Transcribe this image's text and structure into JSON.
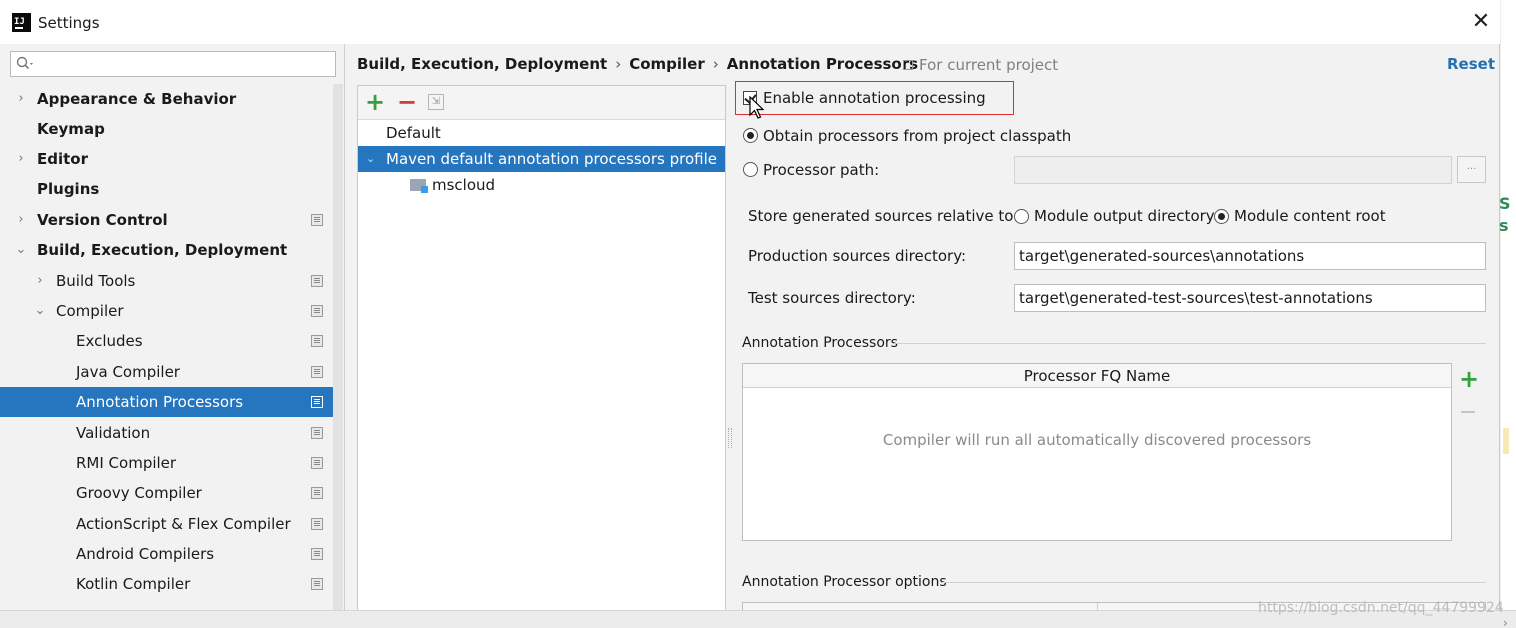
{
  "window": {
    "title": "Settings",
    "close_label": "✕"
  },
  "search": {
    "placeholder": "Q▾"
  },
  "sidebar": {
    "items": [
      {
        "label": "Appearance & Behavior",
        "chevron": "›",
        "bold": true
      },
      {
        "label": "Keymap",
        "chevron": "",
        "bold": true
      },
      {
        "label": "Editor",
        "chevron": "›",
        "bold": true
      },
      {
        "label": "Plugins",
        "chevron": "",
        "bold": true
      },
      {
        "label": "Version Control",
        "chevron": "›",
        "bold": true
      },
      {
        "label": "Build, Execution, Deployment",
        "chevron": "⌄",
        "bold": true
      },
      {
        "label": "Build Tools",
        "chevron": "›",
        "bold": false
      },
      {
        "label": "Compiler",
        "chevron": "⌄",
        "bold": false
      },
      {
        "label": "Excludes",
        "chevron": "",
        "bold": false
      },
      {
        "label": "Java Compiler",
        "chevron": "",
        "bold": false
      },
      {
        "label": "Annotation Processors",
        "chevron": "",
        "bold": false
      },
      {
        "label": "Validation",
        "chevron": "",
        "bold": false
      },
      {
        "label": "RMI Compiler",
        "chevron": "",
        "bold": false
      },
      {
        "label": "Groovy Compiler",
        "chevron": "",
        "bold": false
      },
      {
        "label": "ActionScript & Flex Compiler",
        "chevron": "",
        "bold": false
      },
      {
        "label": "Android Compilers",
        "chevron": "",
        "bold": false
      },
      {
        "label": "Kotlin Compiler",
        "chevron": "",
        "bold": false
      }
    ]
  },
  "breadcrumb": {
    "parts": [
      "Build, Execution, Deployment",
      "Compiler",
      "Annotation Processors"
    ],
    "separator": "›",
    "scope": "For current project",
    "reset": "Reset"
  },
  "profiles": {
    "add": "+",
    "remove": "−",
    "move": "⇲",
    "items": [
      "Default",
      "Maven default annotation processors profile",
      "mscloud"
    ]
  },
  "settings": {
    "enable_label": "Enable annotation processing",
    "enable_checked": true,
    "obtain_label": "Obtain processors from project classpath",
    "processor_path_label": "Processor path:",
    "browse_label": "...",
    "store_label": "Store generated sources relative to:",
    "module_output": "Module output directory",
    "module_content": "Module content root",
    "production_label": "Production sources directory:",
    "production_value": "target\\generated-sources\\annotations",
    "test_label": "Test sources directory:",
    "test_value": "target\\generated-test-sources\\test-annotations"
  },
  "annotation_processors": {
    "title": "Annotation Processors",
    "column": "Processor FQ Name",
    "empty_text": "Compiler will run all automatically discovered processors",
    "add": "+"
  },
  "options": {
    "title": "Annotation Processor options"
  },
  "background": {
    "green_text": "S\ns",
    "watermark": "https://blog.csdn.net/qq_44799924"
  }
}
